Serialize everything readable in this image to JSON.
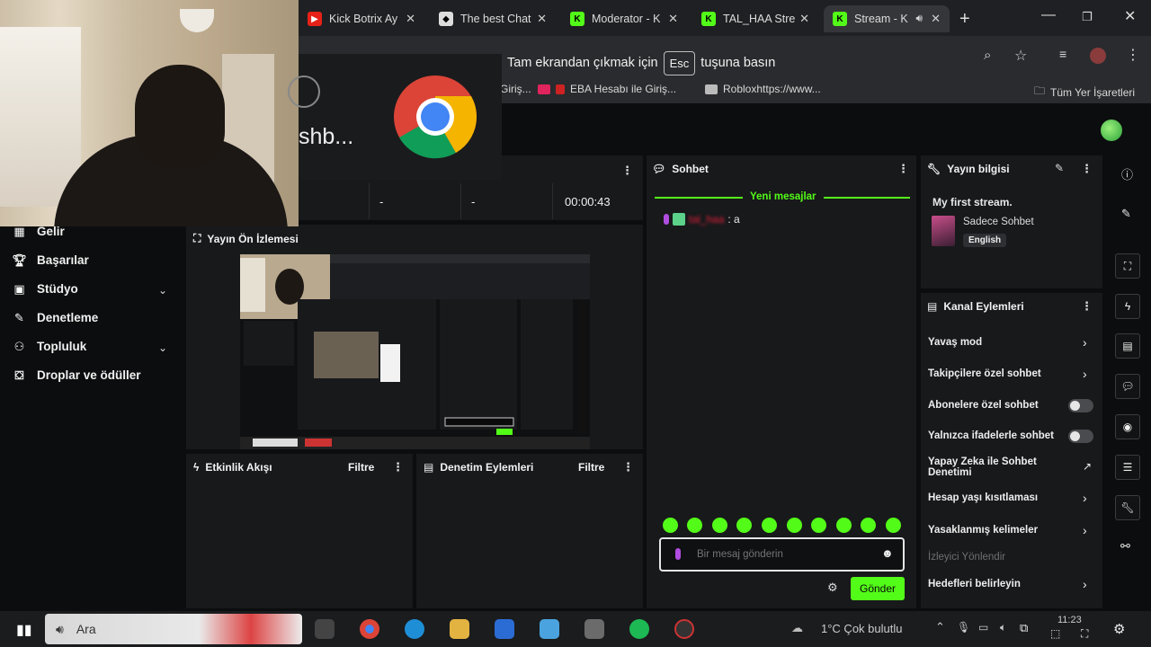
{
  "browser": {
    "tabs": [
      {
        "title": "Kick Botrix Ay",
        "icon": "youtube-icon",
        "color": "#e62117"
      },
      {
        "title": "The best Chat",
        "icon": "shield-icon",
        "color": "#dddddd"
      },
      {
        "title": "Moderator - K",
        "icon": "kick-icon",
        "color": "#53fc18"
      },
      {
        "title": "TAL_HAA Stre",
        "icon": "kick-icon",
        "color": "#53fc18"
      },
      {
        "title": "Stream - K",
        "icon": "kick-icon",
        "color": "#53fc18"
      }
    ],
    "fullscreen_notice": {
      "before": "Tam ekrandan çıkmak için",
      "key": "Esc",
      "after": "tuşuna basın"
    },
    "bookmarks": [
      "Giriş...",
      "EBA Hesabı ile Giriş...",
      "Robloxhttps://www...",
      "Tüm Yer İşaretleri"
    ]
  },
  "overlay": {
    "dashboard_text": "shb..."
  },
  "sidebar": {
    "items": [
      {
        "label": "Gelir",
        "icon": "chart-icon"
      },
      {
        "label": "Başarılar",
        "icon": "trophy-icon"
      },
      {
        "label": "Stüdyo",
        "icon": "studio-icon",
        "expandable": true
      },
      {
        "label": "Denetleme",
        "icon": "wrench-icon"
      },
      {
        "label": "Topluluk",
        "icon": "people-icon",
        "expandable": true
      },
      {
        "label": "Droplar ve ödüller",
        "icon": "gift-icon"
      }
    ]
  },
  "stats": {
    "values": [
      "-",
      "-"
    ],
    "timer": "00:00:43"
  },
  "preview": {
    "title": "Yayın Ön İzlemesi"
  },
  "activity": {
    "title": "Etkinlik Akışı",
    "filter": "Filtre"
  },
  "moderation": {
    "title": "Denetim Eylemleri",
    "filter": "Filtre"
  },
  "chat": {
    "title": "Sohbet",
    "new_messages": "Yeni mesajlar",
    "message": {
      "user": "tal_haa",
      "text": ": a"
    },
    "placeholder": "Bir mesaj gönderin",
    "send": "Gönder",
    "emote_count": 10
  },
  "stream_info": {
    "title": "Yayın bilgisi",
    "stream_title": "My first stream.",
    "category": "Sadece Sohbet",
    "language": "English"
  },
  "channel_actions": {
    "title": "Kanal Eylemleri",
    "items": [
      {
        "label": "Yavaş mod",
        "control": "chevron"
      },
      {
        "label": "Takipçilere özel sohbet",
        "control": "chevron"
      },
      {
        "label": "Abonelere özel sohbet",
        "control": "toggle",
        "on": false
      },
      {
        "label": "Yalnızca ifadelerle sohbet",
        "control": "toggle",
        "on": false
      },
      {
        "label": "Yapay Zeka ile Sohbet Denetimi",
        "control": "external"
      },
      {
        "label": "Hesap yaşı kısıtlaması",
        "control": "chevron"
      },
      {
        "label": "Yasaklanmış kelimeler",
        "control": "chevron"
      }
    ],
    "section": "İzleyici Yönlendir",
    "goals": "Hedefleri belirleyin"
  },
  "taskbar": {
    "search": "Ara",
    "weather": "1°C  Çok bulutlu",
    "time": "11:23"
  },
  "colors": {
    "accent": "#53fc18",
    "panel": "#18191b",
    "background": "#0c0d0e"
  }
}
